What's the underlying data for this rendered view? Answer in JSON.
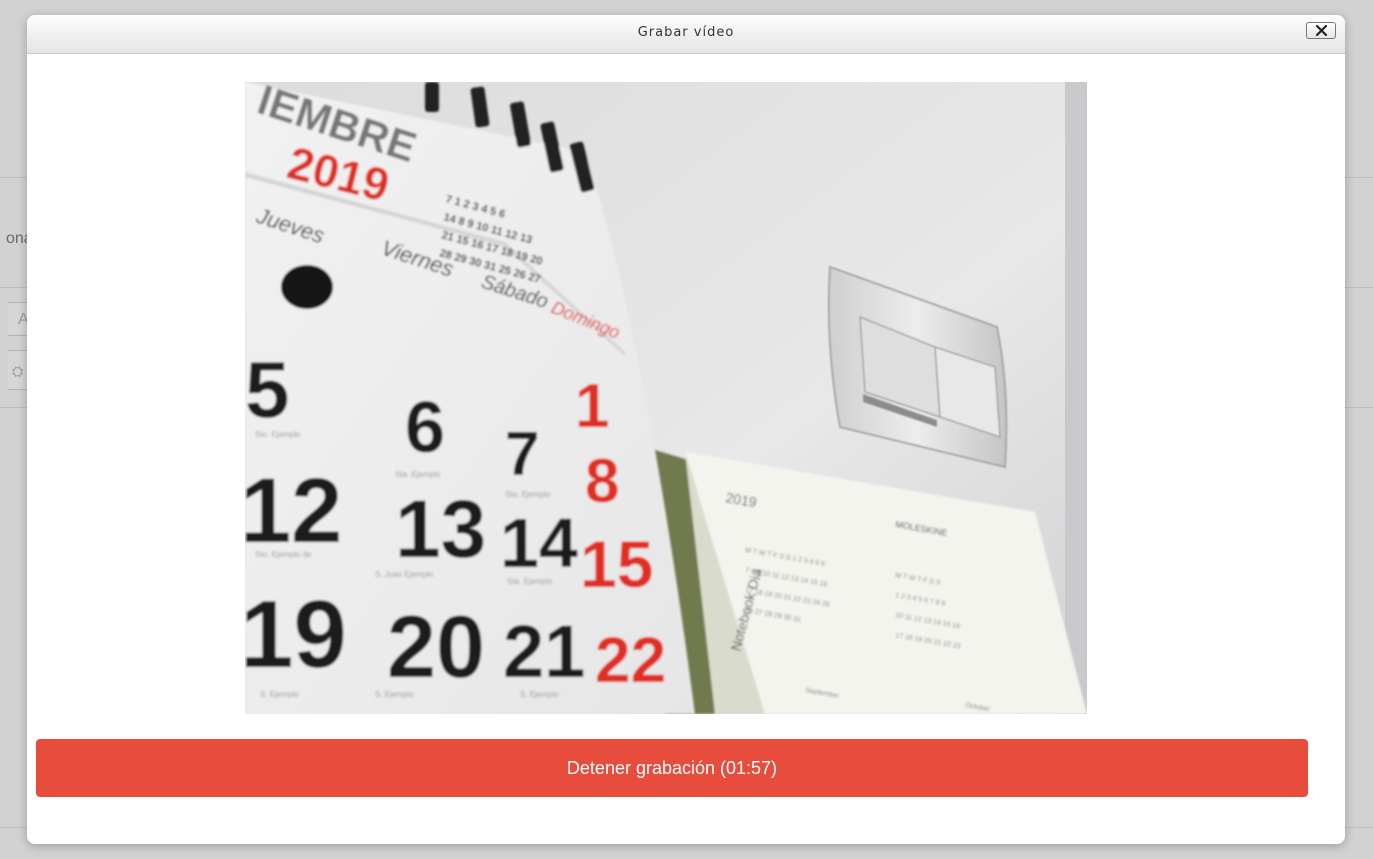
{
  "dialog": {
    "title": "Grabar vídeo",
    "close_label": "×"
  },
  "background": {
    "fragment_text": "ona",
    "field_text": "A",
    "icon_text": "⛭"
  },
  "video_preview": {
    "description_month": "IEMBRE",
    "year": "2019",
    "days": [
      "Jueves",
      "Viernes",
      "Sábado",
      "Domingo"
    ],
    "numbers_black": [
      "5",
      "6",
      "7",
      "12",
      "13",
      "14",
      "19",
      "20",
      "21"
    ],
    "numbers_red": [
      "1",
      "8",
      "15",
      "22"
    ],
    "mini_year": "2019",
    "mini_brand": "MOLESKINE",
    "mini_side": "Notebook Dia"
  },
  "stop_button": {
    "label": "Detener grabación (01:57)",
    "color": "#e84c3d"
  }
}
